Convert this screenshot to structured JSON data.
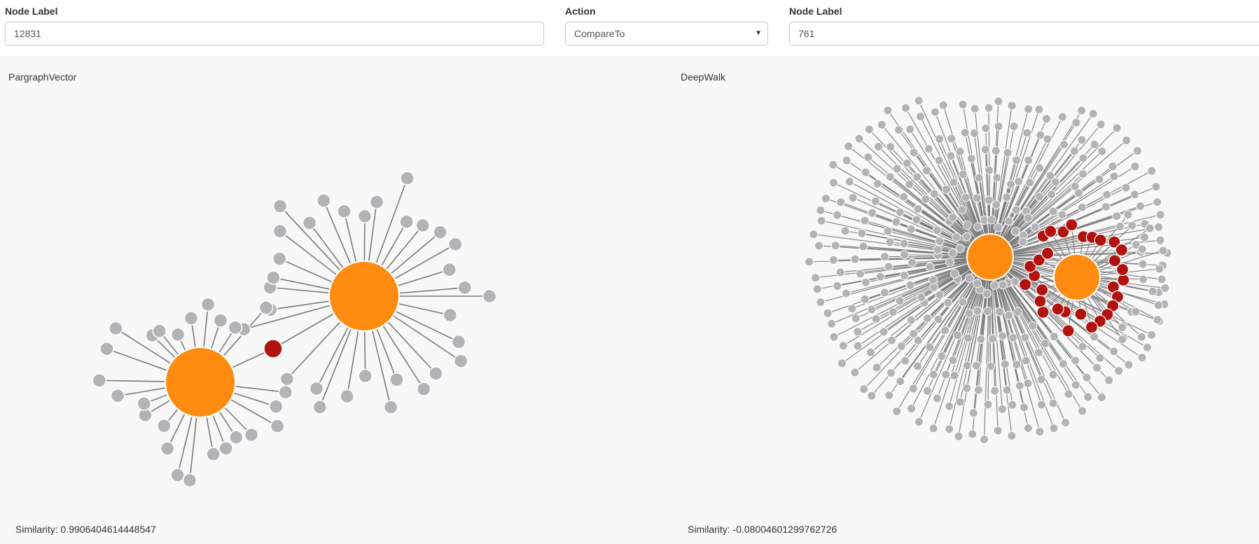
{
  "form": {
    "node1": {
      "label": "Node Label",
      "value": "12831"
    },
    "action": {
      "label": "Action",
      "value": "CompareTo"
    },
    "node2": {
      "label": "Node Label",
      "value": "761"
    }
  },
  "panels": {
    "left": {
      "title": "PargraphVector",
      "similarity": "Similarity: 0.9906404614448547"
    },
    "right": {
      "title": "DeepWalk",
      "similarity": "Similarity: -0.08004601299762726"
    }
  },
  "colors": {
    "hub": "#ff8c11",
    "leaf": "#b2b2b7",
    "shared": "#b1120e",
    "edge": "#7a7a7a",
    "panel_bg": "#f8f8f8"
  }
}
